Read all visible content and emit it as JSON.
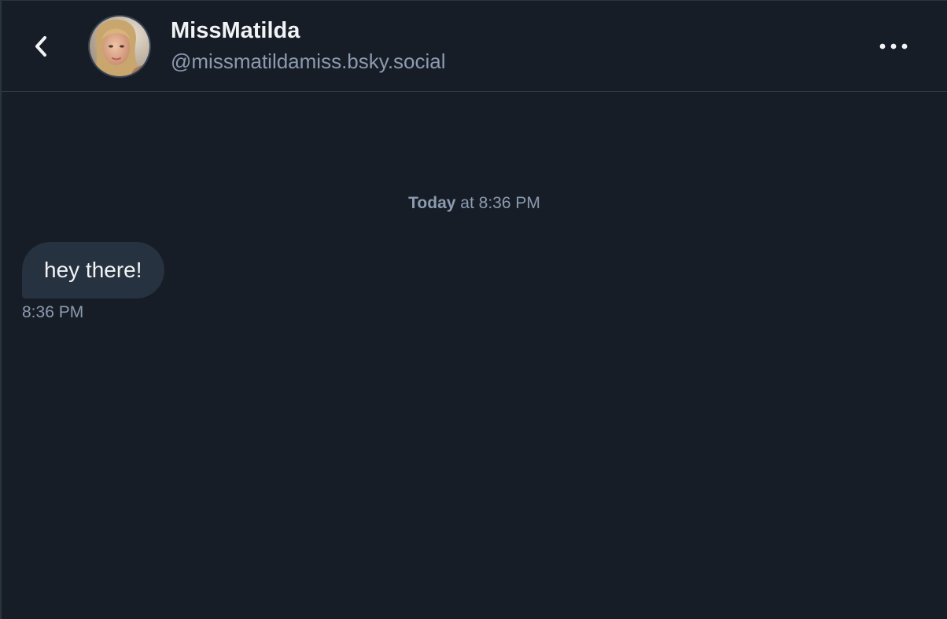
{
  "header": {
    "back_icon": "chevron-left-icon",
    "avatar_alt": "profile photo",
    "display_name": "MissMatilda",
    "handle": "@missmatildamiss.bsky.social",
    "more_icon": "ellipsis-horizontal-icon"
  },
  "conversation": {
    "date_divider": {
      "day": "Today",
      "rest": " at 8:36 PM"
    },
    "messages": [
      {
        "text": "hey there!",
        "time": "8:36 PM",
        "direction": "incoming"
      }
    ]
  },
  "colors": {
    "background": "#171d27",
    "bubble": "#26323f",
    "primary_text": "#f1f3f5",
    "secondary_text": "#8c9baf",
    "divider": "#2e3a48"
  }
}
